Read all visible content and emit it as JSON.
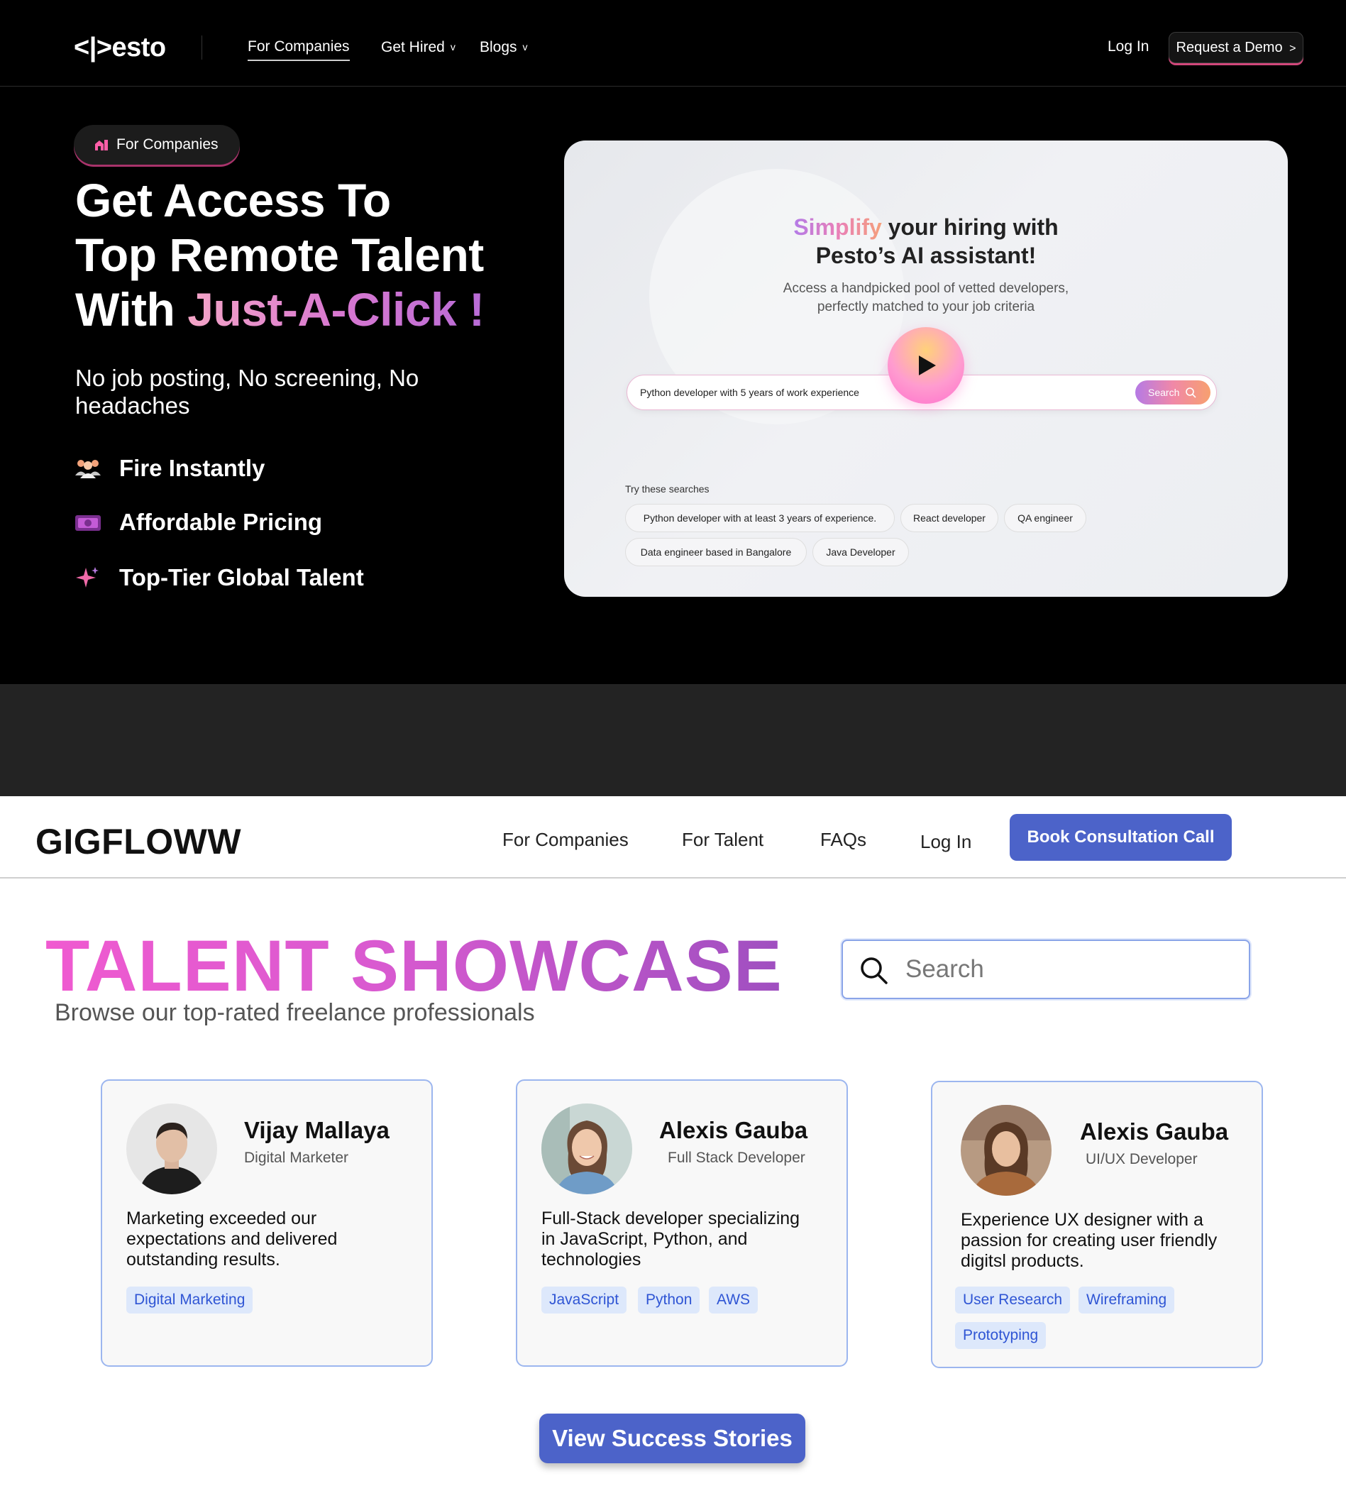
{
  "pesto": {
    "logo": "<|>esto",
    "nav": {
      "links": [
        "For Companies",
        "Get Hired",
        "Blogs"
      ],
      "login": "Log In",
      "demo": "Request a Demo",
      "demo_suffix": ">"
    },
    "badge": "For Companies",
    "hero": {
      "title_line1": "Get Access To",
      "title_line2": "Top Remote Talent",
      "title_line3_plain": "With ",
      "title_line3_grad": "Just-A-Click !",
      "subtitle": "No job posting, No screening, No headaches"
    },
    "features": [
      {
        "icon": "people-icon",
        "label": "Fire Instantly"
      },
      {
        "icon": "money-icon",
        "label": "Affordable Pricing"
      },
      {
        "icon": "sparkle-icon",
        "label": "Top-Tier Global Talent"
      }
    ],
    "video": {
      "title_grad": "Simplify",
      "title_rest": " your hiring with",
      "title_line2": "Pesto’s AI assistant!",
      "desc_line1": "Access a handpicked pool of vetted developers,",
      "desc_line2": "perfectly matched to your job criteria",
      "search_value": "Python developer with 5 years of work experience",
      "search_button": "Search",
      "try_label": "Try these searches",
      "suggestions": [
        "Python developer with at least 3 years of experience.",
        "React developer",
        "QA engineer",
        "Data engineer based in Bangalore",
        "Java Developer"
      ]
    },
    "colors": {
      "accent_pink": "#d1477a",
      "background": "#000000"
    }
  },
  "gigfloww": {
    "logo": "GIGFLOWW",
    "nav": {
      "links": [
        "For Companies",
        "For Talent",
        "FAQs",
        "Log In"
      ],
      "cta": "Book Consultation Call"
    },
    "title": "TALENT SHOWCASE",
    "subtitle": "Browse our top-rated freelance professionals",
    "search_placeholder": "Search",
    "cards": [
      {
        "name": "Vijay Mallaya",
        "role": "Digital Marketer",
        "description": "Marketing exceeded our expectations and delivered outstanding results.",
        "tags": [
          "Digital Marketing"
        ]
      },
      {
        "name": "Alexis Gauba",
        "role": "Full Stack Developer",
        "description": "Full-Stack developer specializing in JavaScript, Python, and technologies",
        "tags": [
          "JavaScript",
          "Python",
          "AWS"
        ]
      },
      {
        "name": "Alexis Gauba",
        "role": "UI/UX Developer",
        "description": "Experience UX designer with a passion for creating user friendly digitsl products.",
        "tags": [
          "User Research",
          "Wireframing",
          "Prototyping"
        ]
      }
    ],
    "cta_bottom": "View Success Stories",
    "colors": {
      "primary": "#4c63c9",
      "tag_bg": "#dde8fb",
      "tag_text": "#2f55d4",
      "card_border": "#9cb6ef"
    }
  }
}
